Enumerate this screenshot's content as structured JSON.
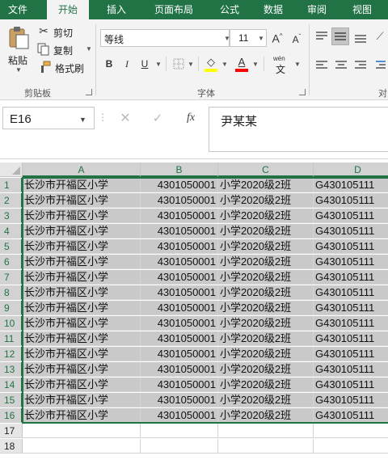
{
  "ribbon": {
    "tabs": [
      {
        "label": "文件",
        "active": false
      },
      {
        "label": "开始",
        "active": true
      },
      {
        "label": "插入",
        "active": false
      },
      {
        "label": "页面布局",
        "active": false
      },
      {
        "label": "公式",
        "active": false
      },
      {
        "label": "数据",
        "active": false
      },
      {
        "label": "审阅",
        "active": false
      },
      {
        "label": "视图",
        "active": false
      }
    ],
    "clipboard": {
      "paste_label": "粘贴",
      "cut_label": "剪切",
      "copy_label": "复制",
      "format_painter_label": "格式刷",
      "group_label": "剪贴板"
    },
    "font": {
      "font_name": "等线",
      "font_size": "11",
      "bold": "B",
      "italic": "I",
      "underline": "U",
      "grow_font": "A",
      "shrink_font": "A",
      "font_color_letter": "A",
      "phonetic_label": "wén",
      "phonetic_char": "文",
      "group_label": "字体"
    },
    "alignment": {
      "group_label": "对"
    }
  },
  "formula_bar": {
    "name_box": "E16",
    "fx_label": "fx",
    "formula": "尹某某"
  },
  "sheet": {
    "columns": [
      "A",
      "B",
      "C",
      "D"
    ],
    "rows": [
      {
        "num": "1",
        "a": "长沙市开福区小学",
        "b": "4301050001",
        "c": "小学2020级2班",
        "d": "G430105111"
      },
      {
        "num": "2",
        "a": "长沙市开福区小学",
        "b": "4301050001",
        "c": "小学2020级2班",
        "d": "G430105111"
      },
      {
        "num": "3",
        "a": "长沙市开福区小学",
        "b": "4301050001",
        "c": "小学2020级2班",
        "d": "G430105111"
      },
      {
        "num": "4",
        "a": "长沙市开福区小学",
        "b": "4301050001",
        "c": "小学2020级2班",
        "d": "G430105111"
      },
      {
        "num": "5",
        "a": "长沙市开福区小学",
        "b": "4301050001",
        "c": "小学2020级2班",
        "d": "G430105111"
      },
      {
        "num": "6",
        "a": "长沙市开福区小学",
        "b": "4301050001",
        "c": "小学2020级2班",
        "d": "G430105111"
      },
      {
        "num": "7",
        "a": "长沙市开福区小学",
        "b": "4301050001",
        "c": "小学2020级2班",
        "d": "G430105111"
      },
      {
        "num": "8",
        "a": "长沙市开福区小学",
        "b": "4301050001",
        "c": "小学2020级2班",
        "d": "G430105111"
      },
      {
        "num": "9",
        "a": "长沙市开福区小学",
        "b": "4301050001",
        "c": "小学2020级2班",
        "d": "G430105111"
      },
      {
        "num": "10",
        "a": "长沙市开福区小学",
        "b": "4301050001",
        "c": "小学2020级2班",
        "d": "G430105111"
      },
      {
        "num": "11",
        "a": "长沙市开福区小学",
        "b": "4301050001",
        "c": "小学2020级2班",
        "d": "G430105111"
      },
      {
        "num": "12",
        "a": "长沙市开福区小学",
        "b": "4301050001",
        "c": "小学2020级2班",
        "d": "G430105111"
      },
      {
        "num": "13",
        "a": "长沙市开福区小学",
        "b": "4301050001",
        "c": "小学2020级2班",
        "d": "G430105111"
      },
      {
        "num": "14",
        "a": "长沙市开福区小学",
        "b": "4301050001",
        "c": "小学2020级2班",
        "d": "G430105111"
      },
      {
        "num": "15",
        "a": "长沙市开福区小学",
        "b": "4301050001",
        "c": "小学2020级2班",
        "d": "G430105111"
      },
      {
        "num": "16",
        "a": "长沙市开福区小学",
        "b": "4301050001",
        "c": "小学2020级2班",
        "d": "G430105111"
      },
      {
        "num": "17",
        "a": "",
        "b": "",
        "c": "",
        "d": ""
      },
      {
        "num": "18",
        "a": "",
        "b": "",
        "c": "",
        "d": ""
      }
    ],
    "selected_rows": 16
  },
  "colors": {
    "accent": "#217346",
    "selection_fill": "#c9c9c9",
    "header_selected": "#d2d2d2"
  }
}
